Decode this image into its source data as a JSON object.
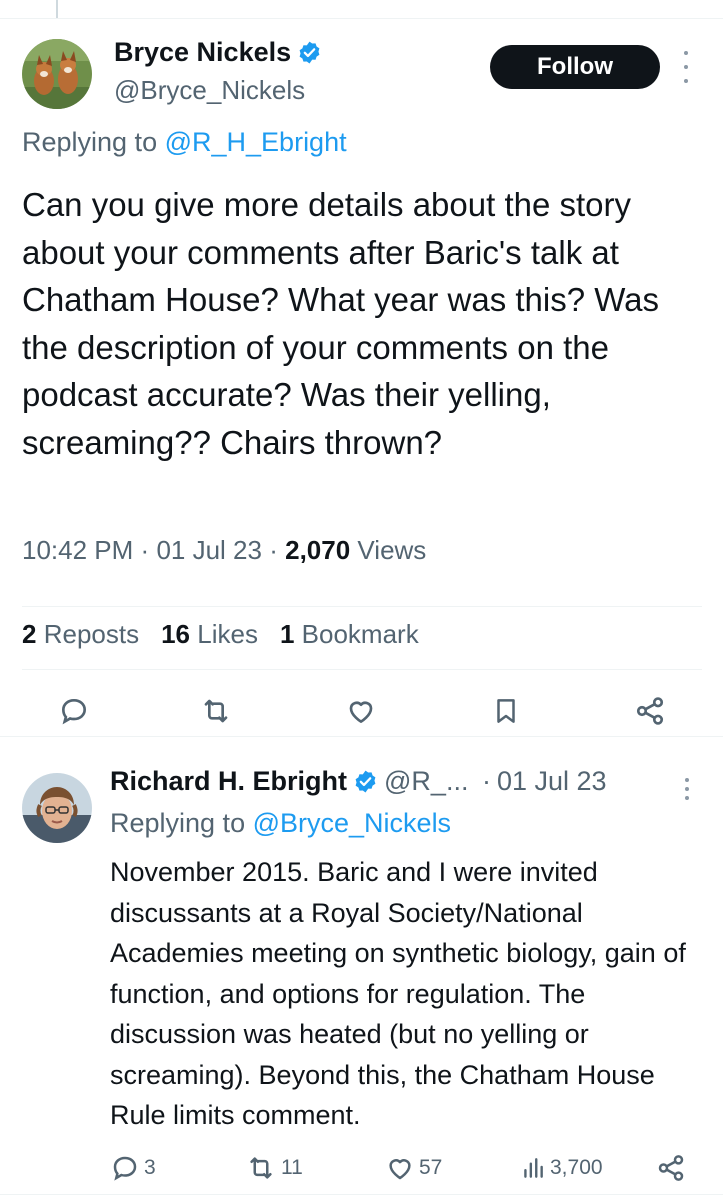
{
  "main_tweet": {
    "author_name": "Bryce Nickels",
    "author_handle": "@Bryce_Nickels",
    "follow_label": "Follow",
    "replying_prefix": "Replying to",
    "replying_to": "@R_H_Ebright",
    "text": "Can you give more details about the story about your comments after Baric's talk at Chatham House? What year was this? Was the description of your comments on the podcast accurate? Was their yelling, screaming?? Chairs thrown?",
    "time": "10:42 PM",
    "date": "01 Jul 23",
    "views_count": "2,070",
    "views_label": "Views",
    "reposts_count": "2",
    "reposts_label": "Reposts",
    "likes_count": "16",
    "likes_label": "Likes",
    "bookmarks_count": "1",
    "bookmarks_label": "Bookmark",
    "icons": [
      "reply-icon",
      "repost-icon",
      "like-icon",
      "bookmark-icon",
      "share-icon"
    ]
  },
  "reply_tweet": {
    "author_name": "Richard H. Ebright",
    "author_handle": "@R_...",
    "date": "01 Jul 23",
    "replying_prefix": "Replying to",
    "replying_to": "@Bryce_Nickels",
    "text": "November 2015. Baric and I were invited discussants at a Royal Society/National Academies meeting on synthetic biology, gain of function, and options for regulation. The discussion was heated (but no yelling or screaming). Beyond this, the Chatham House Rule limits comment.",
    "reply_count": "3",
    "repost_count": "11",
    "like_count": "57",
    "views_count": "3,700"
  },
  "colors": {
    "text_primary": "#0f1419",
    "text_secondary": "#536471",
    "accent": "#1d9bf0",
    "divider": "#eff3f4",
    "follow_bg": "#0f1419"
  }
}
